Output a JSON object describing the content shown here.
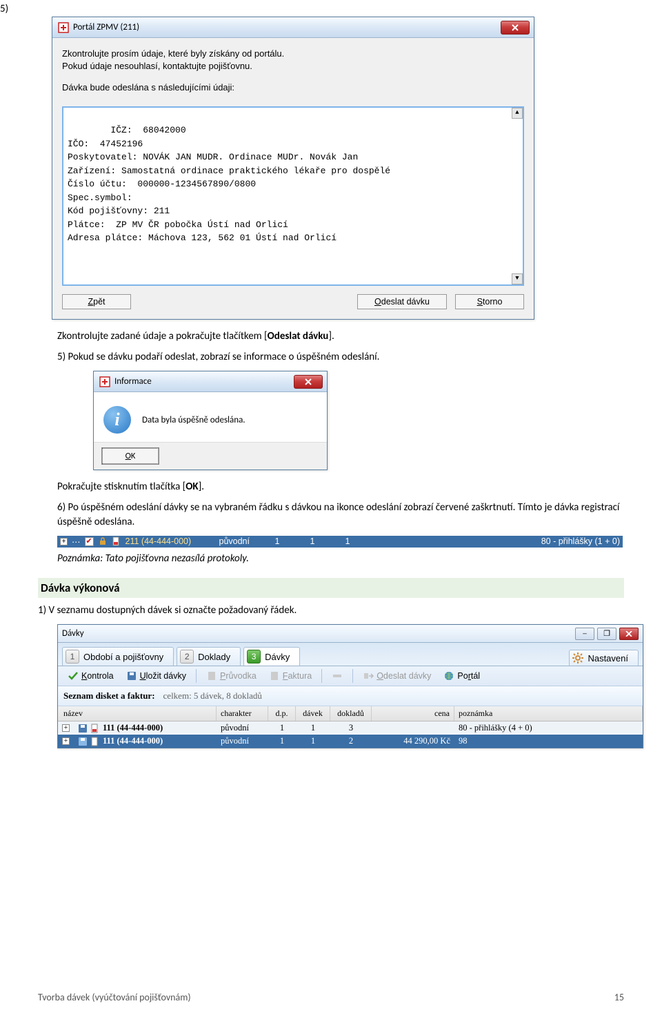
{
  "step5_label": "5)",
  "win1": {
    "title": "Portál ZPMV (211)",
    "intro_line1": "Zkontrolujte prosím údaje, které byly získány od portálu.",
    "intro_line2": "Pokud údaje nesouhlasí, kontaktujte pojišťovnu.",
    "intro_line3": "Dávka bude odeslána s následujícími údaji:",
    "textarea": "IČZ:  68042000\nIČO:  47452196\nPoskytovatel: NOVÁK JAN MUDR. Ordinace MUDr. Novák Jan\nZařízení: Samostatná ordinace praktického lékaře pro dospělé\nČíslo účtu:  000000-1234567890/0800\nSpec.symbol:\nKód pojišťovny: 211\nPlátce:  ZP MV ČR pobočka Ústí nad Orlicí\nAdresa plátce: Máchova 123, 562 01 Ústí nad Orlicí",
    "btn_back_u": "Z",
    "btn_back_rest": "pět",
    "btn_send_u": "O",
    "btn_send_rest": "deslat dávku",
    "btn_cancel_u": "S",
    "btn_cancel_rest": "torno"
  },
  "para1": "Zkontrolujte zadané údaje a pokračujte tlačítkem [Odeslat dávku].",
  "para2": "5) Pokud se dávku podaří odeslat, zobrazí se informace o úspěšném odeslání.",
  "info_dialog": {
    "title": "Informace",
    "msg": "Data byla úspěšně odeslána.",
    "ok_u": "O",
    "ok_rest": "K"
  },
  "para3": "Pokračujte stisknutím tlačítka [OK].",
  "para4": "6) Po úspěšném odeslání dávky se na vybraném řádku s dávkou na ikonce odeslání zobrazí červené zaškrtnutí. Tímto je dávka registrací úspěšně odeslána.",
  "tree_row": {
    "name": "211 (44-444-000)",
    "char": "původní",
    "dp": "1",
    "davek": "1",
    "dokladu": "1",
    "poznamka": "80 - přihlášky (1 + 0)"
  },
  "note": "Poznámka: Tato pojišťovna nezasílá protokoly.",
  "section": "Dávka výkonová",
  "para5": "1) V seznamu dostupných dávek si označte požadovaný řádek.",
  "davky": {
    "title": "Dávky",
    "tabs": {
      "t1_num": "1",
      "t1": "Období a pojišťovny",
      "t2_num": "2",
      "t2": "Doklady",
      "t3_num": "3",
      "t3": "Dávky",
      "t4": "Nastavení"
    },
    "toolbar": {
      "kontrola_u": "K",
      "kontrola_rest": "ontrola",
      "ulozit_u": "U",
      "ulozit_rest": "ložit dávky",
      "pruvodka_u": "P",
      "pruvodka_rest": "růvodka",
      "faktura_u": "F",
      "faktura_rest": "aktura",
      "odeslat_u": "O",
      "odeslat_rest": "deslat dávky",
      "portal_u": "r",
      "portal_pre": "Po",
      "portal_post": "tál"
    },
    "list_title": "Seznam disket a faktur:",
    "list_sub": "celkem: 5 dávek, 8 dokladů",
    "cols": {
      "nazev": "název",
      "char": "charakter",
      "dp": "d.p.",
      "davek": "dávek",
      "dokladu": "dokladů",
      "cena": "cena",
      "poznamka": "poznámka"
    },
    "rows": [
      {
        "name": "111 (44-444-000)",
        "char": "původní",
        "dp": "1",
        "davek": "1",
        "dokladu": "3",
        "cena": "",
        "poznamka": "80 - přihlášky (4 + 0)",
        "selected": false
      },
      {
        "name": "111 (44-444-000)",
        "char": "původní",
        "dp": "1",
        "davek": "1",
        "dokladu": "2",
        "cena": "44 290,00 Kč",
        "poznamka": "98",
        "selected": true
      }
    ]
  },
  "footer_left": "Tvorba dávek (vyúčtování pojišťovnám)",
  "footer_right": "15"
}
